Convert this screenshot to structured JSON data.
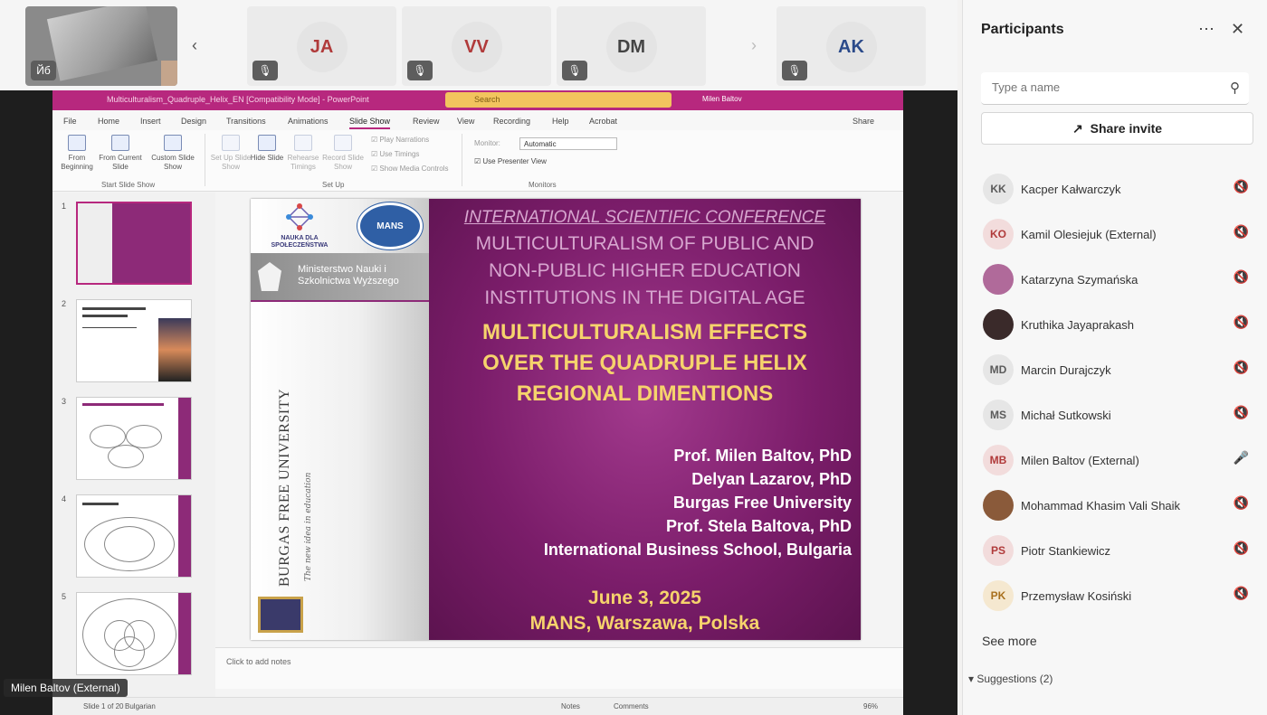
{
  "top_strip": {
    "tiles": [
      {
        "initials": "JA"
      },
      {
        "initials": "VV"
      },
      {
        "initials": "DM"
      },
      {
        "initials": "AK"
      }
    ],
    "camera_badge": "Йб",
    "muted_icon": "mic-off-icon"
  },
  "ppt": {
    "window_title": "Multiculturalism_Quadruple_Helix_EN [Compatibility Mode] - PowerPoint",
    "search_placeholder": "Search",
    "user": "Milen Baltov",
    "tabs": [
      "File",
      "Home",
      "Insert",
      "Design",
      "Transitions",
      "Animations",
      "Slide Show",
      "Review",
      "View",
      "Recording",
      "Help",
      "Acrobat"
    ],
    "active_tab": "Slide Show",
    "share_label": "Share",
    "ribbon": {
      "from_beginning": "From Beginning",
      "from_current": "From Current Slide",
      "custom_show": "Custom Slide Show",
      "start_group": "Start Slide Show",
      "setup_show": "Set Up Slide Show",
      "hide_slide": "Hide Slide",
      "rehearse": "Rehearse Timings",
      "record": "Record Slide Show",
      "play_narrations": "Play Narrations",
      "use_timings": "Use Timings",
      "show_media": "Show Media Controls",
      "setup_group": "Set Up",
      "monitor_label": "Monitor:",
      "monitor_value": "Automatic",
      "presenter_view": "Use Presenter View",
      "monitors_group": "Monitors"
    },
    "thumbnail_numbers": [
      "1",
      "2",
      "3",
      "4",
      "5"
    ],
    "notes_placeholder": "Click to add notes",
    "status": {
      "slide_of": "Slide 1 of 20",
      "language": "Bulgarian",
      "notes": "Notes",
      "comments": "Comments",
      "zoom": "96%"
    }
  },
  "slide": {
    "nauka_label": "NAUKA DLA SPOŁECZEŃSTWA",
    "mans_logo": "MANS",
    "ministry": "Ministerstwo Nauki i Szkolnictwa Wyższego",
    "university": "BURGAS FREE UNIVERSITY",
    "motto": "The new idea in education",
    "conference": "INTERNATIONAL SCIENTIFIC CONFERENCE",
    "subtitle_lines": [
      "MULTICULTURALISM OF PUBLIC AND",
      "NON-PUBLIC HIGHER EDUCATION",
      "INSTITUTIONS IN THE DIGITAL AGE"
    ],
    "title_lines": [
      "MULTICULTURALISM EFFECTS",
      "OVER THE QUADRUPLE HELIX",
      "REGIONAL DIMENTIONS"
    ],
    "authors": [
      "Prof. Milen Baltov, PhD",
      "Delyan Lazarov, PhD",
      "Burgas Free University",
      "Prof. Stela Baltova, PhD",
      "International Business School, Bulgaria"
    ],
    "date": "June 3, 2025",
    "place": "MANS, Warszawa, Polska"
  },
  "presenter_label": "Milen Baltov (External)",
  "panel": {
    "title": "Participants",
    "search_placeholder": "Type a name",
    "share_invite": "Share invite",
    "participants": [
      {
        "initials": "KK",
        "name": "Kacper Kałwarczyk",
        "mic": "mic-off-icon",
        "color": "#5b5b5b",
        "bg": "#e6e6e6"
      },
      {
        "initials": "KO",
        "name": "Kamil Olesiejuk (External)",
        "mic": "mic-off-icon",
        "color": "#b03a3a",
        "bg": "#f2dcdc"
      },
      {
        "initials": "",
        "name": "Katarzyna Szymańska",
        "mic": "mic-off-icon",
        "color": "#fff",
        "bg": "#b06a9a"
      },
      {
        "initials": "",
        "name": "Kruthika Jayaprakash",
        "mic": "mic-off-icon",
        "color": "#fff",
        "bg": "#3a2a2a"
      },
      {
        "initials": "MD",
        "name": "Marcin Durajczyk",
        "mic": "mic-off-icon",
        "color": "#5b5b5b",
        "bg": "#e6e6e6"
      },
      {
        "initials": "MS",
        "name": "Michał Sutkowski",
        "mic": "mic-off-icon",
        "color": "#5b5b5b",
        "bg": "#e6e6e6"
      },
      {
        "initials": "MB",
        "name": "Milen Baltov (External)",
        "mic": "mic-on-icon",
        "color": "#b03a3a",
        "bg": "#f2dcdc"
      },
      {
        "initials": "",
        "name": "Mohammad Khasim Vali Shaik",
        "mic": "mic-off-icon",
        "color": "#fff",
        "bg": "#8a5a3a"
      },
      {
        "initials": "PS",
        "name": "Piotr Stankiewicz",
        "mic": "mic-off-icon",
        "color": "#b03a3a",
        "bg": "#f2dcdc"
      },
      {
        "initials": "PK",
        "name": "Przemysław Kosiński",
        "mic": "mic-off-icon",
        "color": "#a8701e",
        "bg": "#f5e8d0"
      }
    ],
    "see_more": "See more",
    "suggestions": "Suggestions (2)"
  }
}
